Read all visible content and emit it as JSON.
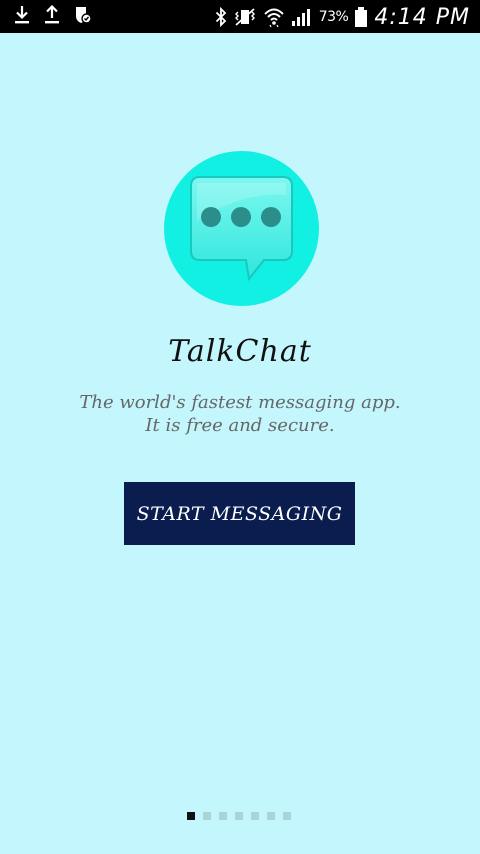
{
  "status_bar": {
    "left_icons": [
      "download-icon",
      "upload-icon",
      "shield-icon"
    ],
    "right_icons": [
      "bluetooth-icon",
      "vibrate-icon",
      "wifi-icon",
      "signal-icon",
      "battery-icon"
    ],
    "battery_percent": "73%",
    "time": "4:14 PM"
  },
  "app": {
    "logo_icon": "chat-bubble-icon",
    "title": "TalkChat",
    "tagline_line1": "The world's fastest messaging app.",
    "tagline_line2": "It is free and secure.",
    "start_button_label": "START MESSAGING"
  },
  "pager": {
    "page_count": 7,
    "active_index": 0
  },
  "colors": {
    "background": "#c3f7fd",
    "logo_circle": "#12f0e4",
    "button": "#0b1d4f"
  }
}
